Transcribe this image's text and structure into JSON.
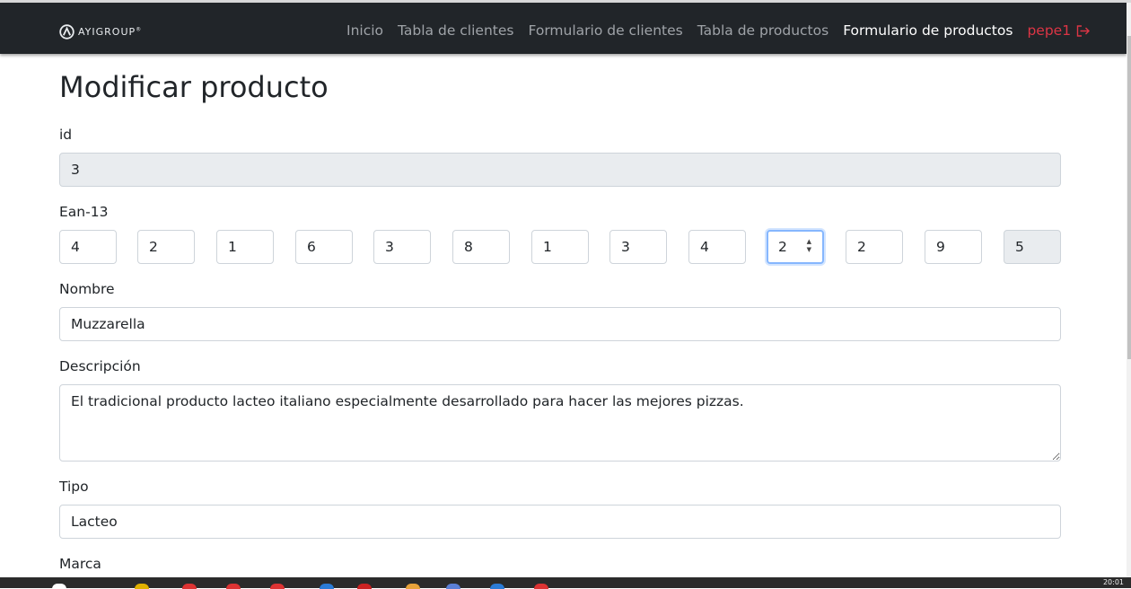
{
  "navbar": {
    "brand": "AYIGROUP",
    "brand_mark": "®",
    "links": [
      {
        "label": "Inicio",
        "active": false
      },
      {
        "label": "Tabla de clientes",
        "active": false
      },
      {
        "label": "Formulario de clientes",
        "active": false
      },
      {
        "label": "Tabla de productos",
        "active": false
      },
      {
        "label": "Formulario de productos",
        "active": true
      }
    ],
    "user": "pepe1",
    "logout_icon": "logout-icon"
  },
  "page": {
    "title": "Modificar producto"
  },
  "form": {
    "id": {
      "label": "id",
      "value": "3",
      "disabled": true
    },
    "ean": {
      "label": "Ean-13",
      "digits": [
        "4",
        "2",
        "1",
        "6",
        "3",
        "8",
        "1",
        "3",
        "4",
        "2",
        "2",
        "9",
        "5"
      ],
      "focused_index": 9,
      "check_digit_disabled": true
    },
    "nombre": {
      "label": "Nombre",
      "value": "Muzzarella"
    },
    "descripcion": {
      "label": "Descripción",
      "value": "El tradicional producto lacteo italiano especialmente desarrollado para hacer las mejores pizzas."
    },
    "tipo": {
      "label": "Tipo",
      "value": "Lacteo"
    },
    "marca": {
      "label": "Marca"
    }
  },
  "taskbar": {
    "clock": "20:01"
  },
  "colors": {
    "navbar_bg": "#212529",
    "nav_link": "#9fa3a8",
    "nav_active": "#ffffff",
    "user_red": "#dc3545",
    "disabled_bg": "#e9ecef",
    "focus_border": "#86b7fe"
  }
}
